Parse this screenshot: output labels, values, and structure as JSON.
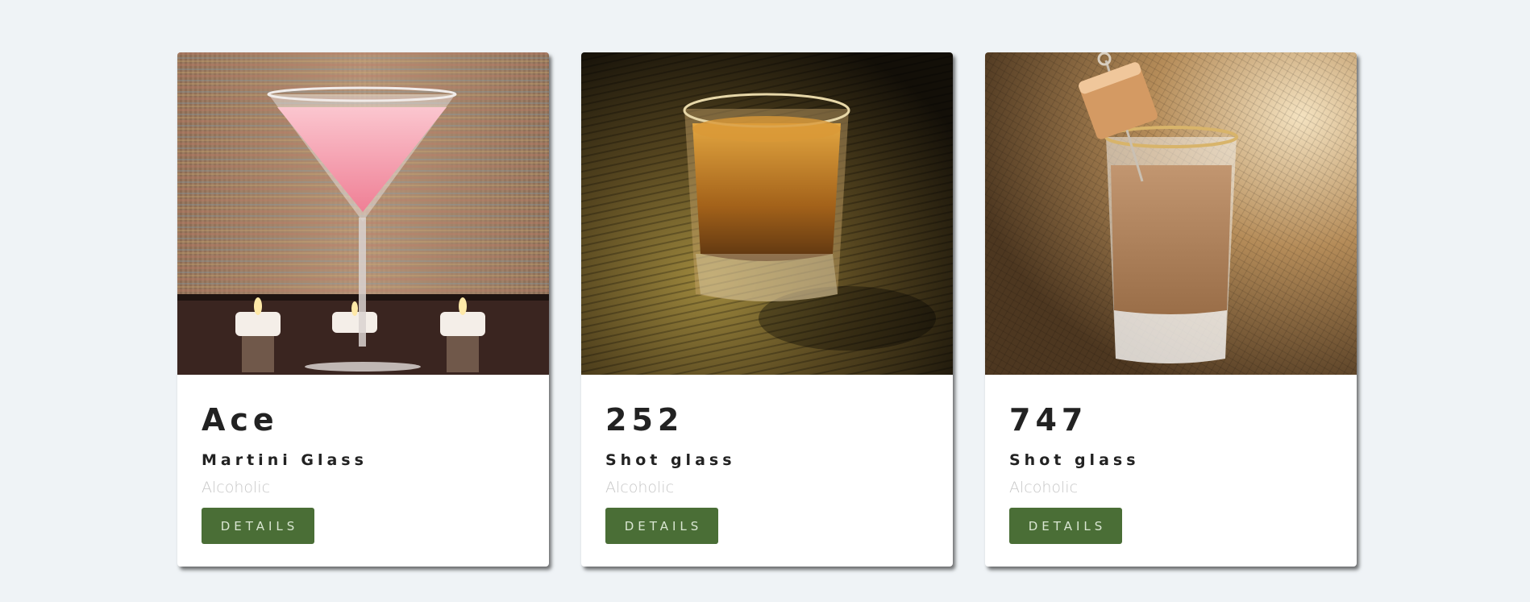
{
  "cards": [
    {
      "name": "Ace",
      "glass": "Martini Glass",
      "category": "Alcoholic",
      "button": "DETAILS",
      "image": "pink-martini-cocktail-photo"
    },
    {
      "name": "252",
      "glass": "Shot glass",
      "category": "Alcoholic",
      "button": "DETAILS",
      "image": "whiskey-shot-glass-photo"
    },
    {
      "name": "747",
      "glass": "Shot glass",
      "category": "Alcoholic",
      "button": "DETAILS",
      "image": "cream-liqueur-shot-photo"
    }
  ],
  "colors": {
    "page_background": "#eff3f6",
    "card_background": "#ffffff",
    "button": "#4a6e36",
    "button_text": "#d9e6d2",
    "title_text": "#222222",
    "category_text": "#c7c7c7"
  }
}
